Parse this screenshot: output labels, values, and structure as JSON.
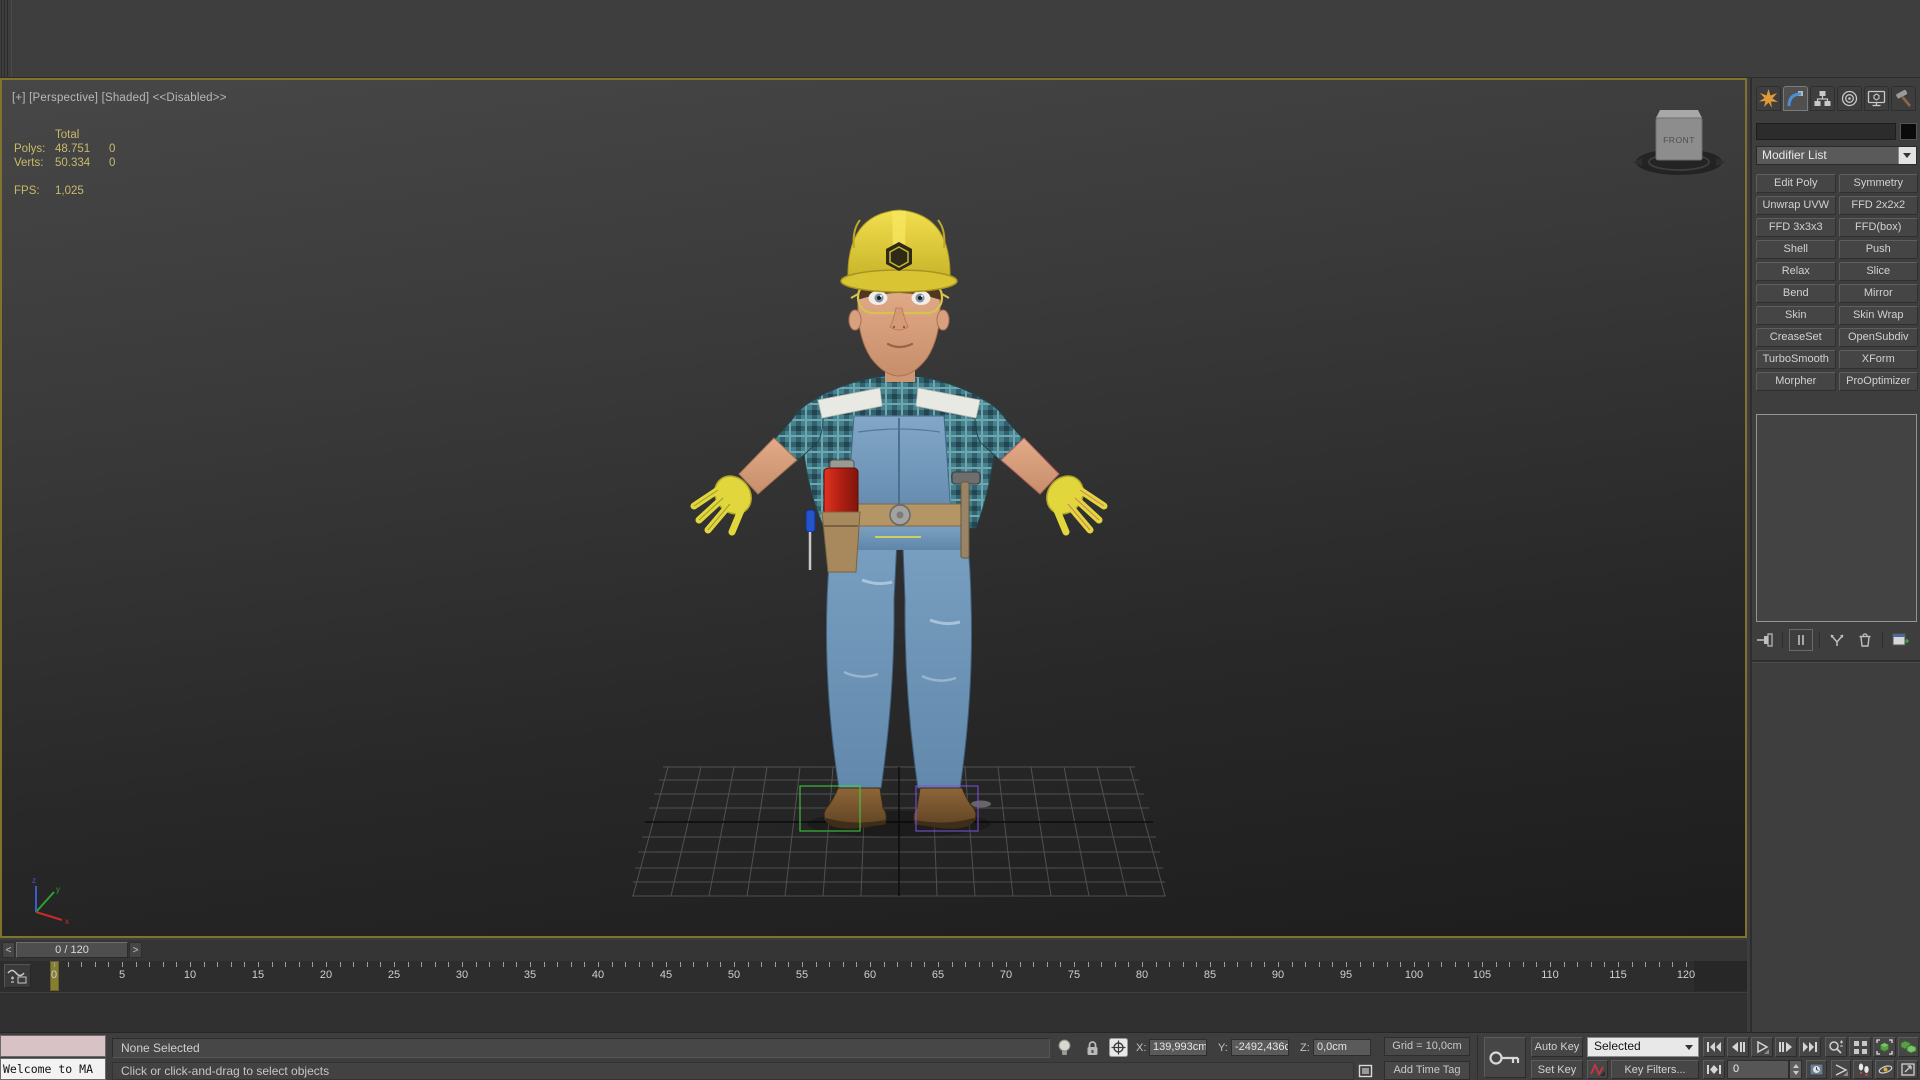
{
  "viewport": {
    "label": "[+] [Perspective] [Shaded]  <<Disabled>>",
    "stats": {
      "total_header": "Total",
      "polys_label": "Polys:",
      "polys_value": "48.751",
      "polys_col2": "0",
      "verts_label": "Verts:",
      "verts_value": "50.334",
      "verts_col2": "0",
      "fps_label": "FPS:",
      "fps_value": "1,025"
    },
    "viewcube": {
      "front_face": "FRONT"
    }
  },
  "command_panel": {
    "tabs": [
      "create",
      "modify",
      "hierarchy",
      "motion",
      "display",
      "utilities"
    ],
    "active_tab": "modify",
    "object_name_value": "",
    "modifier_list_label": "Modifier List",
    "modifier_buttons": [
      "Edit Poly",
      "Symmetry",
      "Unwrap UVW",
      "FFD 2x2x2",
      "FFD 3x3x3",
      "FFD(box)",
      "Shell",
      "Push",
      "Relax",
      "Slice",
      "Bend",
      "Mirror",
      "Skin",
      "Skin Wrap",
      "CreaseSet",
      "OpenSubdiv",
      "TurboSmooth",
      "XForm",
      "Morpher",
      "ProOptimizer"
    ]
  },
  "timeline": {
    "time_display": "0 / 120",
    "prev_arrow": "<",
    "next_arrow": ">",
    "start": 0,
    "end": 120,
    "label_step": 5,
    "current_frame": 0
  },
  "status_bar": {
    "listener_text": "Welcome to MA",
    "status_line": "None Selected",
    "prompt_line": "Click or click-and-drag to select objects",
    "x_label": "X:",
    "x_value": "139,993cm",
    "y_label": "Y:",
    "y_value": "-2492,436c",
    "z_label": "Z:",
    "z_value": "0,0cm",
    "grid_display": "Grid = 10,0cm",
    "add_time_tag": "Add Time Tag",
    "auto_key_label": "Auto Key",
    "set_key_label": "Set Key",
    "selection_set_value": "Selected",
    "key_filters_label": "Key Filters...",
    "frame_field_value": "0"
  },
  "colors": {
    "viewport_border": "#80722f",
    "stats_text": "#c9ba6b",
    "hat_yellow": "#e3ce37",
    "denim_blue": "#7aa0c2",
    "shirt_teal": "#47828f",
    "glove_yellow": "#e2d63d",
    "boot_brown": "#7a5a33",
    "selection_green": "#3fd43f",
    "selection_purple": "#7a55dd",
    "marker_olive": "#8f8631"
  }
}
